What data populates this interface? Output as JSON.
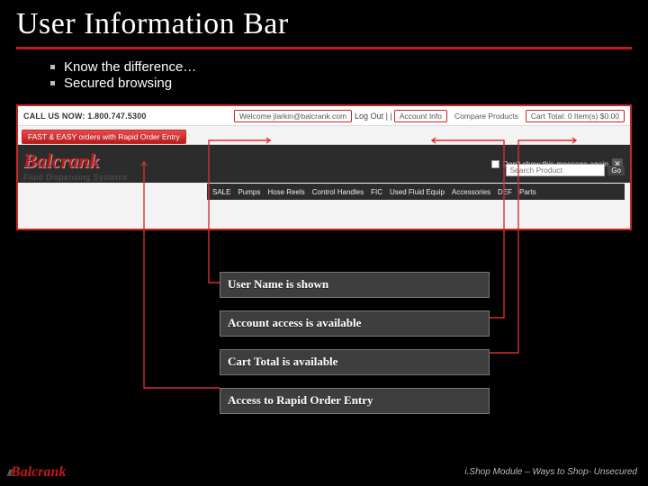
{
  "title": "User Information Bar",
  "bullets": [
    "Know the difference…",
    "Secured browsing"
  ],
  "shot": {
    "callus": "CALL US NOW: 1.800.747.5300",
    "welcome": "Welcome jlarkin@balcrank.com",
    "logout": "Log Out | |",
    "account_info": "Account Info",
    "compare": "Compare Products",
    "cart": "Cart Total: 0 Item(s) $0.00",
    "promo": "FAST & EASY orders with Rapid Order Entry",
    "dont_show": "Don't show this message again",
    "brand": "Balcrank",
    "brand_tag": "Fluid Dispensing Systems",
    "search_placeholder": "Search Product",
    "go": "Go",
    "menu": [
      "SALE",
      "Pumps",
      "Hose Reels",
      "Control Handles",
      "FIC",
      "Used Fluid Equip",
      "Accessories",
      "DEF",
      "Parts"
    ]
  },
  "labels": [
    "User Name is shown",
    "Account access is available",
    "Cart Total is available",
    "Access to Rapid Order Entry"
  ],
  "footer_brand": "Balcrank",
  "footer_text": "i.Shop Module – Ways to Shop- Unsecured"
}
